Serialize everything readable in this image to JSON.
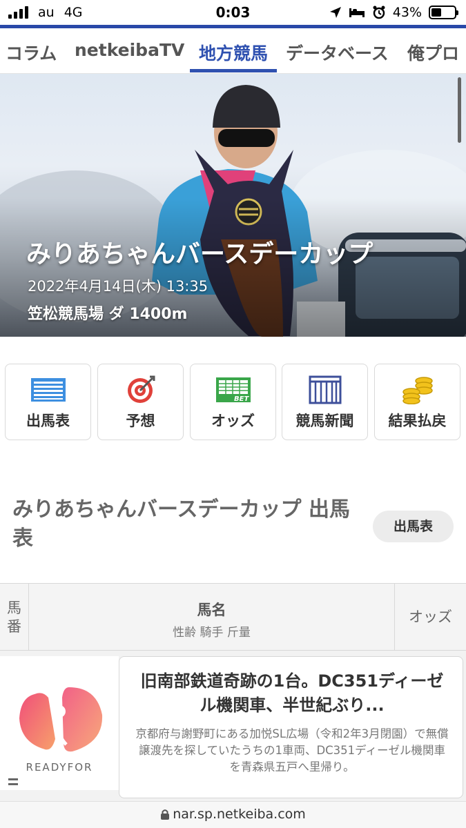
{
  "status_bar": {
    "carrier": "au",
    "network": "4G",
    "time": "0:03",
    "battery_percent": "43%",
    "battery_level": 0.43
  },
  "nav": {
    "tabs": [
      {
        "label": "コラム",
        "active": false
      },
      {
        "label": "netkeibaTV",
        "active": false
      },
      {
        "label": "地方競馬",
        "active": true
      },
      {
        "label": "データベース",
        "active": false
      },
      {
        "label": "俺プロ",
        "active": false
      }
    ],
    "accent_color": "#2f51b0"
  },
  "hero": {
    "race_name": "みりあちゃんバースデーカップ",
    "datetime": "2022年4月14日(木) 13:35",
    "venue_course": "笠松競馬場 ダ 1400m"
  },
  "quick_menu": [
    {
      "label": "出馬表",
      "icon": "race-card-icon"
    },
    {
      "label": "予想",
      "icon": "target-icon"
    },
    {
      "label": "オッズ",
      "icon": "odds-bet-icon"
    },
    {
      "label": "競馬新聞",
      "icon": "newspaper-icon"
    },
    {
      "label": "結果払戻",
      "icon": "coins-icon"
    }
  ],
  "section": {
    "title": "みりあちゃんバースデーカップ 出馬表",
    "button_label": "出馬表"
  },
  "table": {
    "col_number": "馬番",
    "col_name": "馬名",
    "col_name_sub": "性齢 騎手 斤量",
    "col_odds": "オッズ"
  },
  "ad": {
    "brand": "READYFOR",
    "title": "旧南部鉄道奇跡の1台。DC351ディーゼル機関車、半世紀ぶり...",
    "description": "京都府与謝野町にある加悦SL広場（令和2年3月閉園）で無償譲渡先を探していたうちの1車両、DC351ディーゼル機関車を青森県五戸へ里帰り。"
  },
  "url_bar": {
    "url": "nar.sp.netkeiba.com"
  }
}
